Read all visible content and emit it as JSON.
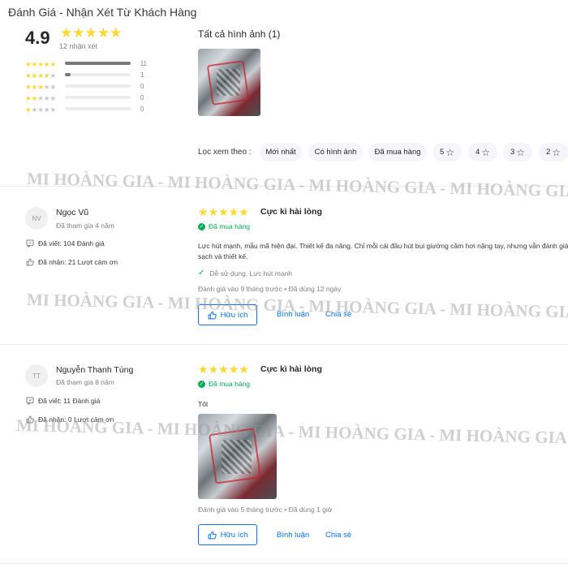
{
  "page_title": "Đánh Giá - Nhận Xét Từ Khách Hàng",
  "summary": {
    "score": "4.9",
    "count_text": "12 nhận xét",
    "distribution": [
      {
        "stars": 5,
        "count": "11",
        "fill": 1.0
      },
      {
        "stars": 4,
        "count": "1",
        "fill": 0.09
      },
      {
        "stars": 3,
        "count": "0",
        "fill": 0
      },
      {
        "stars": 2,
        "count": "0",
        "fill": 0
      },
      {
        "stars": 1,
        "count": "0",
        "fill": 0
      }
    ]
  },
  "images": {
    "title": "Tất cả hình ảnh (1)"
  },
  "filter": {
    "label": "Lọc xem theo :",
    "chips": [
      "Mới nhất",
      "Có hình ảnh",
      "Đã mua hàng",
      "5",
      "4",
      "3",
      "2"
    ]
  },
  "reviews": [
    {
      "initials": "NV",
      "name": "Ngọc Vũ",
      "joined": "Đã tham gia 4 năm",
      "written": "Đã viết: 104 Đánh giá",
      "thanks": "Đã nhận: 21 Lượt cảm ơn",
      "title": "Cực kì hài lòng",
      "bought": "Đã mua hàng",
      "body": "Lực hút mạnh, mẫu mã hiện đại. Thiết kế đa năng. Chỉ mỗi cái đầu hút bụi giường cầm hơi nặng tay, nhưng vẫn đánh giá sạch và thiết kế.",
      "attributes": "Dễ sử dụng, Lực hút mạnh",
      "date": "Đánh giá vào 9 tháng trước  •  Đã dùng 12 ngày",
      "helpful": "Hữu ích",
      "comment": "Bình luận",
      "share": "Chia sẻ"
    },
    {
      "initials": "TT",
      "name": "Nguyễn Thanh Tùng",
      "joined": "Đã tham gia 8 năm",
      "written": "Đã viết: 11 Đánh giá",
      "thanks": "Đã nhận: 0 Lượt cảm ơn",
      "title": "Cực kì hài lòng",
      "bought": "Đã mua hàng",
      "body": "Tốt",
      "date": "Đánh giá vào 5 tháng trước  •  Đã dùng 1 giờ",
      "helpful": "Hữu ích",
      "comment": "Bình luận",
      "share": "Chia sẻ"
    }
  ],
  "watermark": "MI HOÀNG GIA - MI HOÀNG GIA - MI HOÀNG GIA - MI HOÀNG GIA",
  "colors": {
    "star": "#fdd835",
    "accent": "#0b74e5",
    "success": "#00ab56"
  }
}
